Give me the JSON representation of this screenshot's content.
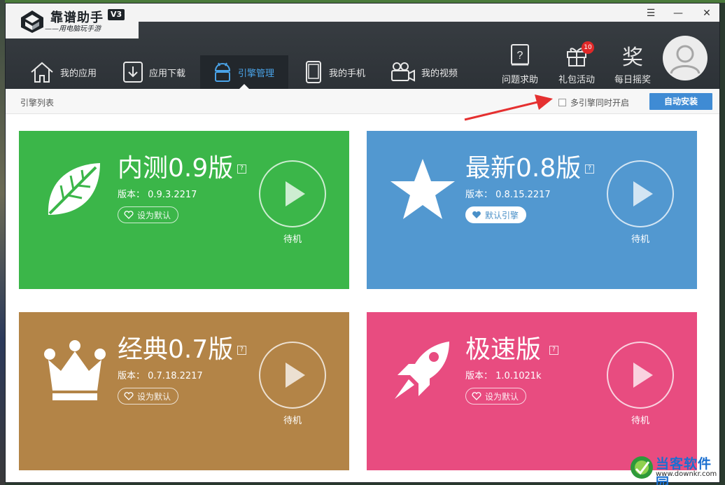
{
  "window": {
    "title": "靠谱助手",
    "subtitle": "——用电脑玩手游",
    "version_badge": "V3"
  },
  "controls": {
    "menu": "☰",
    "minimize": "—",
    "close": "✕"
  },
  "nav": {
    "items": [
      {
        "label": "我的应用",
        "icon": "home-icon"
      },
      {
        "label": "应用下载",
        "icon": "download-icon"
      },
      {
        "label": "引擎管理",
        "icon": "android-icon",
        "active": true
      },
      {
        "label": "我的手机",
        "icon": "phone-icon"
      },
      {
        "label": "我的视频",
        "icon": "video-camera-icon"
      }
    ]
  },
  "tools": {
    "help": "问题求助",
    "gift": "礼包活动",
    "gift_badge": "10",
    "lottery": "每日摇奖",
    "lottery_glyph": "奖"
  },
  "subbar": {
    "title": "引擎列表",
    "multi_engine_label": "多引擎同时开启",
    "multi_engine_checked": false,
    "auto_install": "自动安装"
  },
  "engines": [
    {
      "name": "内测0.9版",
      "version": "版本： 0.9.3.2217",
      "default_label": "设为默认",
      "is_default": false,
      "status": "待机",
      "color": "#3bb649",
      "icon": "leaf-icon"
    },
    {
      "name": "最新0.8版",
      "version": "版本： 0.8.15.2217",
      "default_label": "默认引擎",
      "is_default": true,
      "status": "待机",
      "color": "#5298d0",
      "icon": "star-icon"
    },
    {
      "name": "经典0.7版",
      "version": "版本： 0.7.18.2217",
      "default_label": "设为默认",
      "is_default": false,
      "status": "待机",
      "color": "#b38447",
      "icon": "crown-icon"
    },
    {
      "name": "极速版",
      "version": "版本： 1.0.1021k",
      "default_label": "设为默认",
      "is_default": false,
      "status": "待机",
      "color": "#e84c80",
      "icon": "rocket-icon"
    }
  ],
  "help_mark": "?",
  "watermark": {
    "text": "当客软件园",
    "url": "www.downkr.com"
  }
}
